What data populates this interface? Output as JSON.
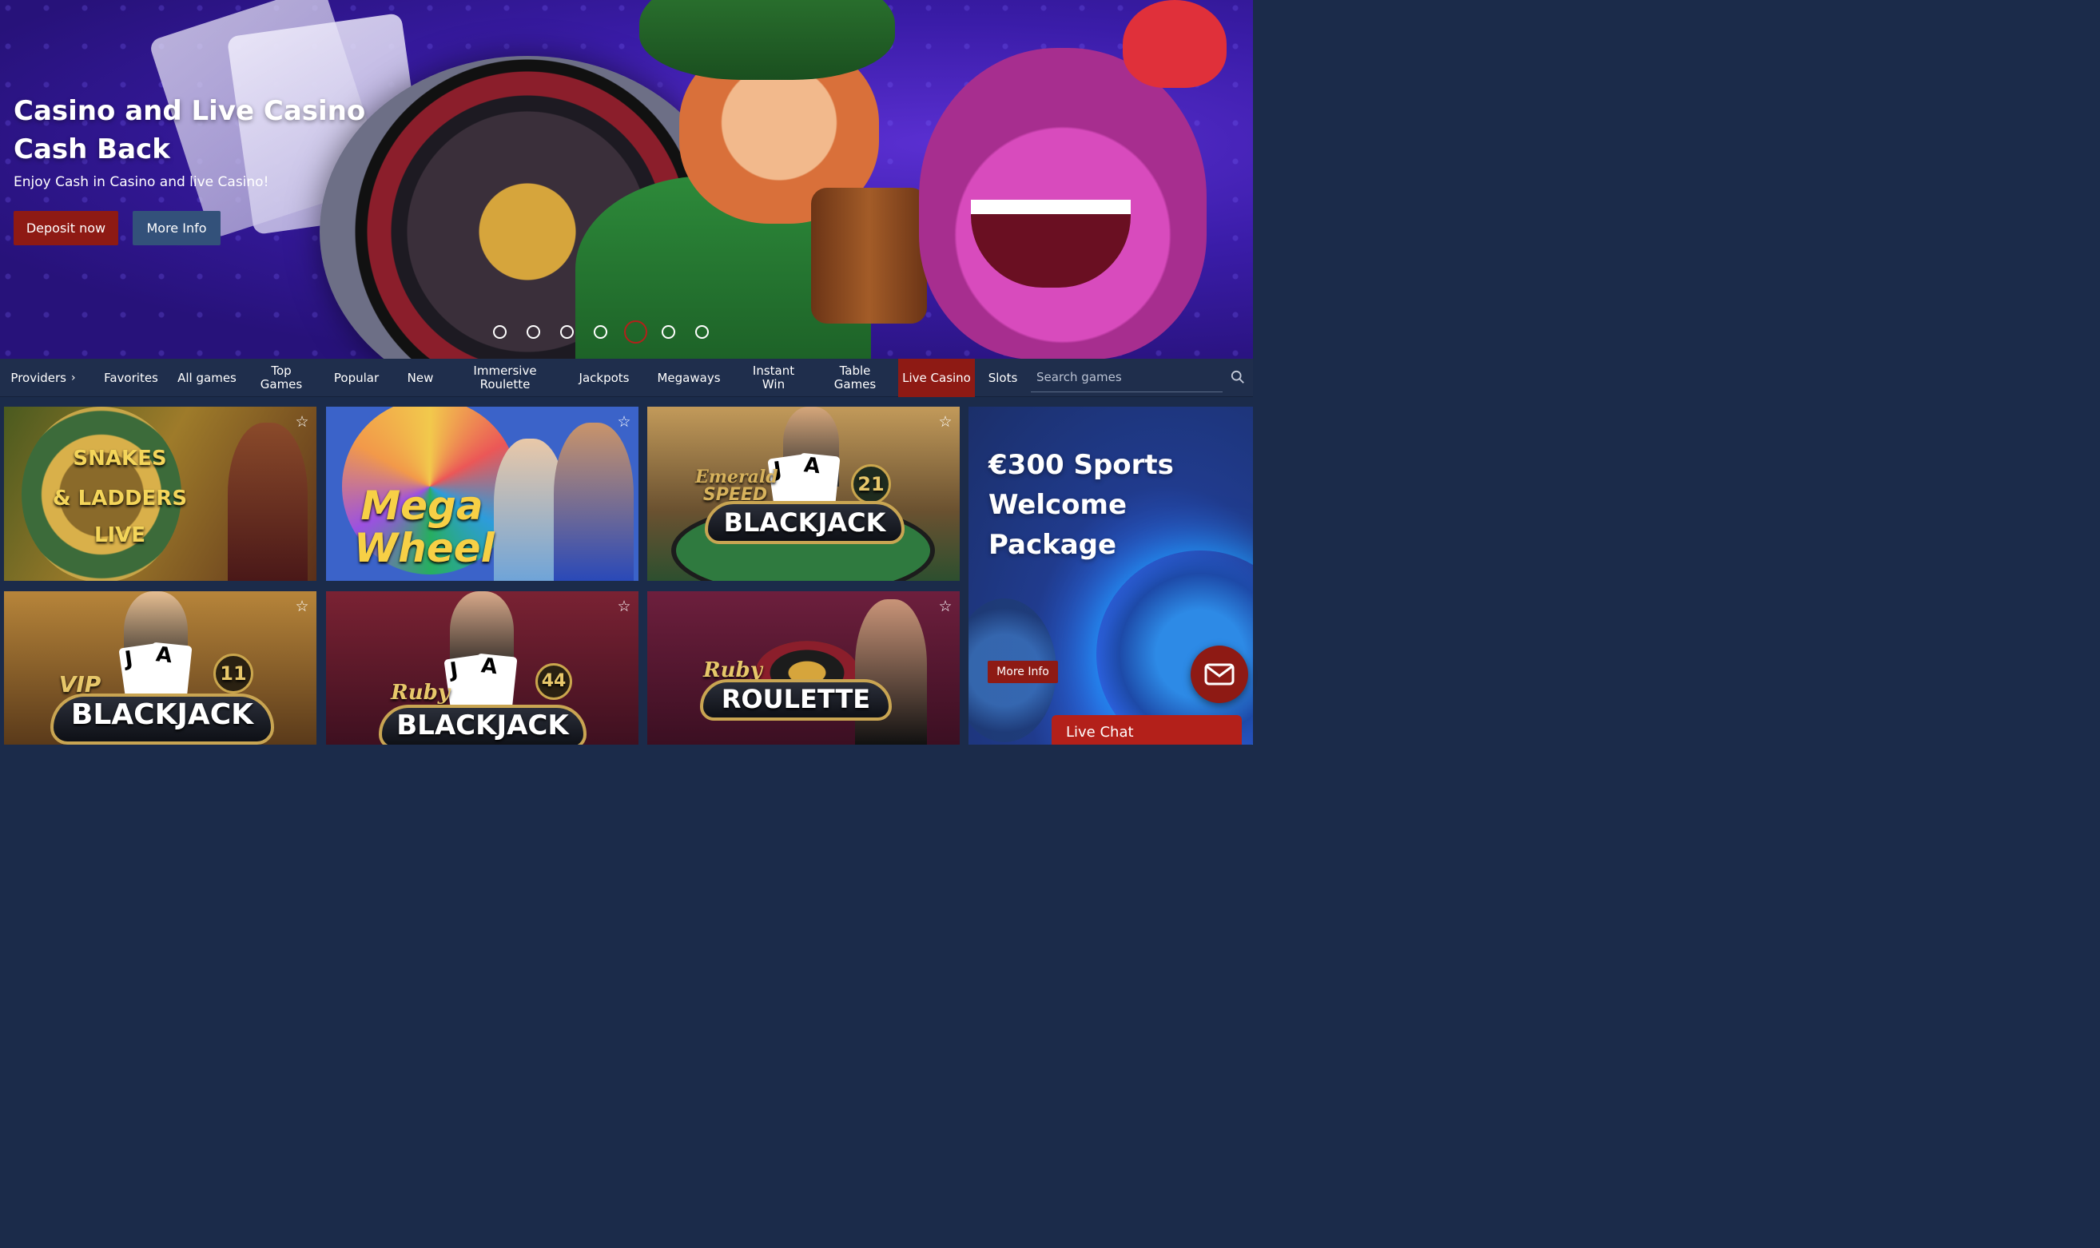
{
  "hero": {
    "title": "Casino and Live Casino Cash Back",
    "subtitle": "Enjoy Cash in Casino and live Casino!",
    "deposit_label": "Deposit now",
    "more_info_label": "More Info",
    "slides_count": 7,
    "active_slide": 5
  },
  "nav": {
    "items": [
      {
        "label": "Providers"
      },
      {
        "label": "Favorites"
      },
      {
        "label": "All games"
      },
      {
        "label": "Top Games"
      },
      {
        "label": "Popular"
      },
      {
        "label": "New"
      },
      {
        "label": "Immersive Roulette"
      },
      {
        "label": "Jackpots"
      },
      {
        "label": "Megaways"
      },
      {
        "label": "Instant Win"
      },
      {
        "label": "Table Games"
      },
      {
        "label": "Live Casino"
      },
      {
        "label": "Slots"
      }
    ],
    "active": "Live Casino",
    "search_placeholder": "Search games"
  },
  "games": [
    {
      "name": "SNAKES & LADDERS LIVE",
      "line1": "SNAKES",
      "line2": "& LADDERS",
      "line3": "LIVE",
      "favorite": false
    },
    {
      "name": "Mega Wheel",
      "line1": "Mega",
      "line2": "Wheel",
      "favorite": false
    },
    {
      "name": "Emerald Speed Blackjack",
      "line1": "Emerald",
      "line2": "SPEED",
      "line3": "BLACKJACK",
      "number": "21",
      "favorite": false
    },
    {
      "name": "VIP Blackjack",
      "line1": "VIP",
      "line2": "BLACKJACK",
      "number": "11",
      "favorite": false
    },
    {
      "name": "Ruby Blackjack",
      "line1": "Ruby",
      "line2": "BLACKJACK",
      "number": "44",
      "favorite": false
    },
    {
      "name": "Ruby Roulette",
      "line1": "Ruby",
      "line2": "ROULETTE",
      "favorite": false
    }
  ],
  "promo": {
    "title": "€300 Sports Welcome Package",
    "more_info_label": "More Info"
  },
  "chat": {
    "label": "Live Chat"
  },
  "colors": {
    "accent_red": "#8e1a14",
    "nav_bg": "#1f2e4c",
    "secondary_button": "#33517a"
  }
}
